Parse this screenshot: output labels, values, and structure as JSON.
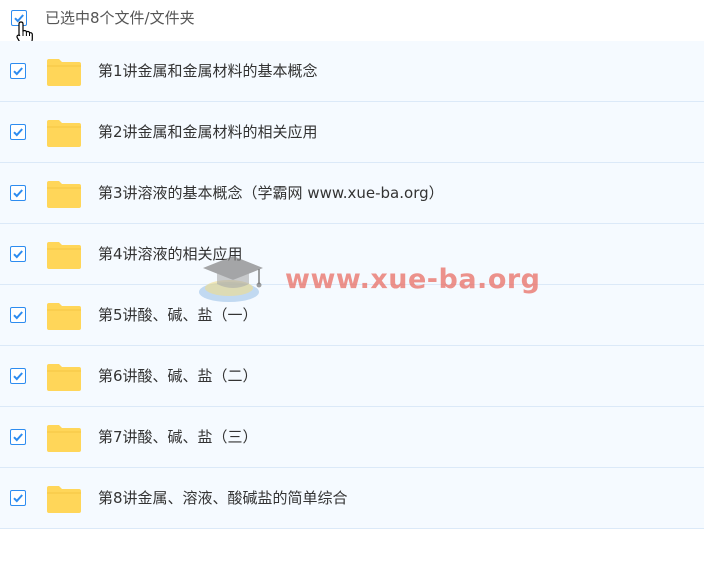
{
  "header": {
    "select_all_checked": true,
    "selection_text": "已选中8个文件/文件夹"
  },
  "files": [
    {
      "name": "第1讲金属和金属材料的基本概念",
      "checked": true,
      "icon": "folder-icon"
    },
    {
      "name": "第2讲金属和金属材料的相关应用",
      "checked": true,
      "icon": "folder-icon"
    },
    {
      "name": "第3讲溶液的基本概念（学霸网 www.xue-ba.org）",
      "checked": true,
      "icon": "folder-icon"
    },
    {
      "name": "第4讲溶液的相关应用",
      "checked": true,
      "icon": "folder-icon"
    },
    {
      "name": "第5讲酸、碱、盐（一）",
      "checked": true,
      "icon": "folder-icon"
    },
    {
      "name": "第6讲酸、碱、盐（二）",
      "checked": true,
      "icon": "folder-icon"
    },
    {
      "name": "第7讲酸、碱、盐（三）",
      "checked": true,
      "icon": "folder-icon"
    },
    {
      "name": "第8讲金属、溶液、酸碱盐的简单综合",
      "checked": true,
      "icon": "folder-icon"
    }
  ],
  "watermark": {
    "text": "www.xue-ba.org"
  },
  "colors": {
    "accent": "#2d8cf0",
    "folder": "#ffd659",
    "row_bg": "#f5faff",
    "row_border": "#dbe9f8"
  }
}
